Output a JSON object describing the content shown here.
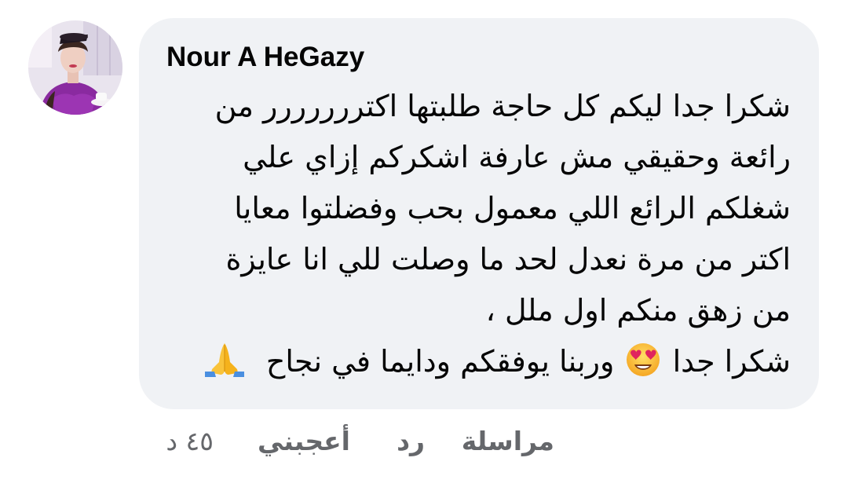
{
  "comment": {
    "author": "Nour A HeGazy",
    "avatar_icon": "profile-photo",
    "message_lines": [
      "شكرا جدا ليكم كل حاجة طلبتها اكتررررررر من",
      "رائعة وحقيقي مش عارفة اشكركم إزاي علي",
      "شغلكم الرائع اللي معمول بحب وفضلتوا معايا",
      "اكتر من مرة نعدل لحد ما وصلت للي انا عايزة",
      "من زهق منكم اول ملل ،"
    ],
    "last_line": {
      "before_emoji": "شكرا جدا",
      "after_emoji": "وربنا يوفقكم ودايما في نجاح",
      "face_emoji_icon": "heart-eyes-emoji",
      "hands_emoji_icon": "folded-hands-emoji"
    }
  },
  "actions": {
    "message_label": "مراسلة",
    "reply_label": "رد",
    "like_label": "أعجبني",
    "timestamp": "٤٥ د"
  },
  "colors": {
    "bubble_bg": "#f0f2f5",
    "text": "#050505",
    "secondary_text": "#65676b"
  }
}
